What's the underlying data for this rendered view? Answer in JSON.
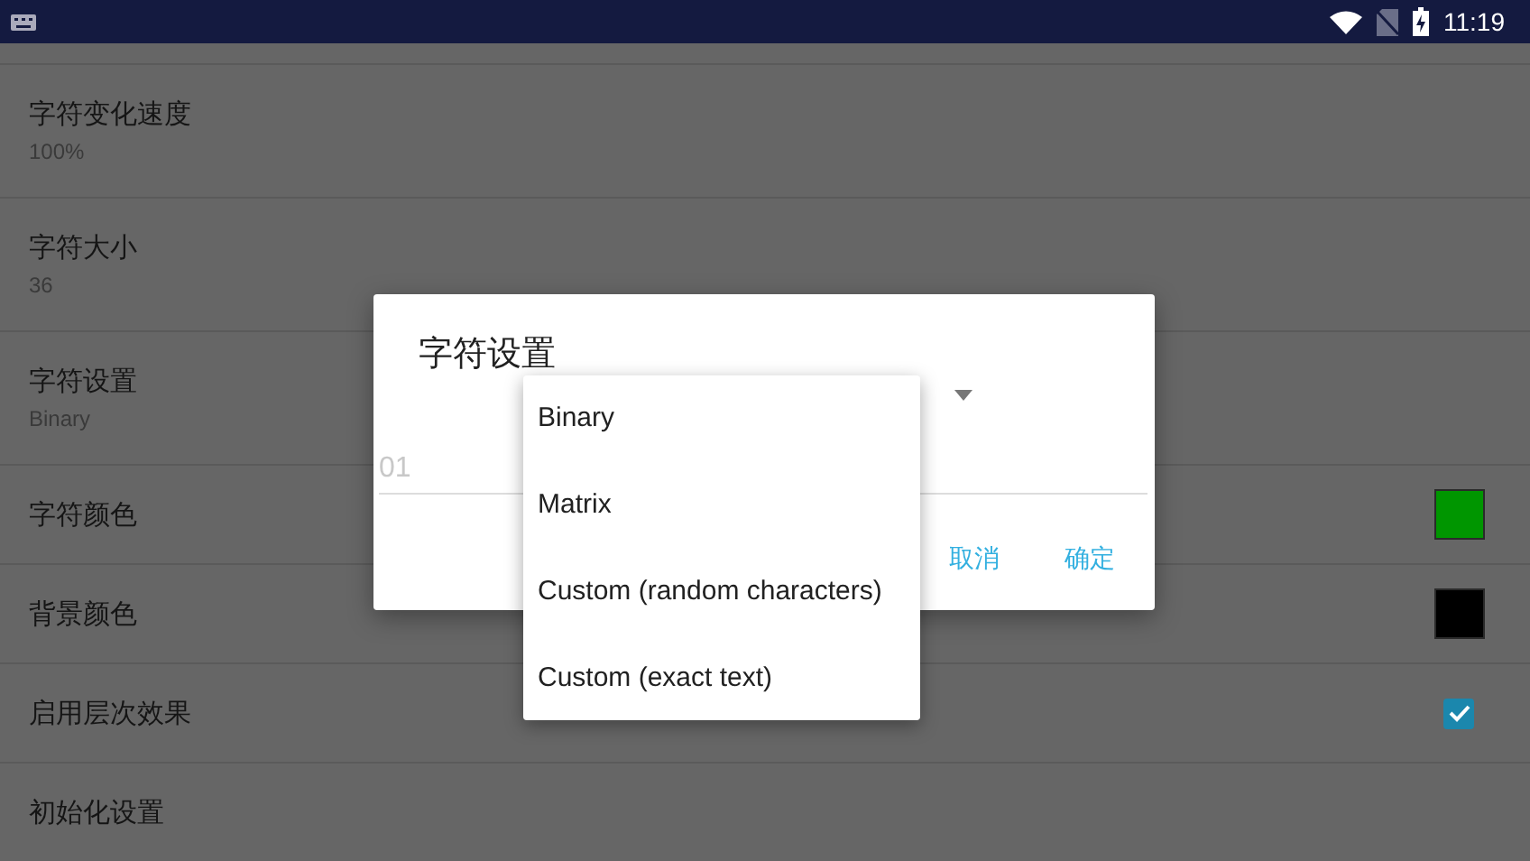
{
  "status_bar": {
    "time": "11:19"
  },
  "settings": [
    {
      "kind": "text",
      "title": "字符变化速度",
      "summary": "100%"
    },
    {
      "kind": "text",
      "title": "字符大小",
      "summary": "36"
    },
    {
      "kind": "text",
      "title": "字符设置",
      "summary": "Binary"
    },
    {
      "kind": "color",
      "title": "字符颜色",
      "color": "#009600"
    },
    {
      "kind": "color",
      "title": "背景颜色",
      "color": "#000000"
    },
    {
      "kind": "checkbox",
      "title": "启用层次效果",
      "checked": true
    },
    {
      "kind": "text",
      "title": "初始化设置"
    }
  ],
  "dialog": {
    "title": "字符设置",
    "input": {
      "placeholder": "01"
    },
    "buttons": [
      "取消",
      "确定"
    ]
  },
  "dropdown_menu": {
    "items": [
      "Binary",
      "Matrix",
      "Custom (random characters)",
      "Custom (exact text)"
    ]
  }
}
